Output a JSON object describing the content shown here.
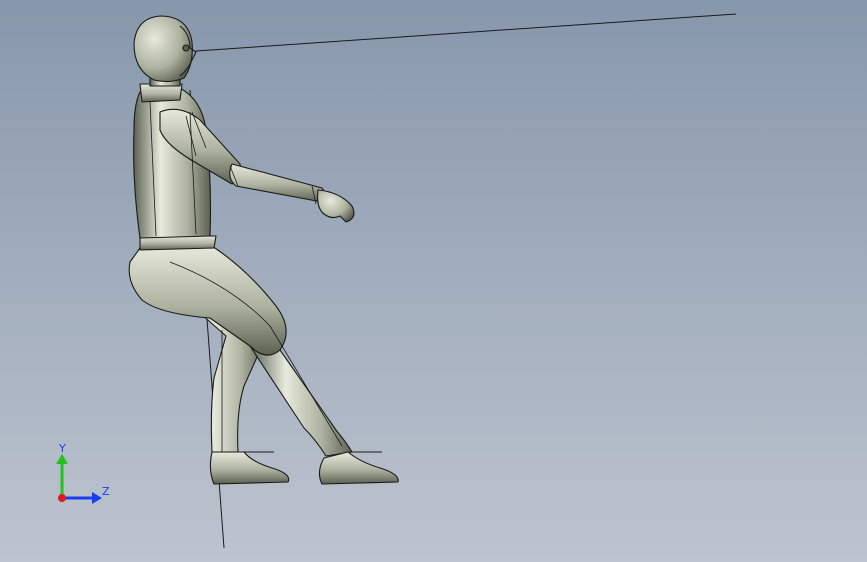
{
  "viewport": {
    "background_top": "#8797ab",
    "background_bottom": "#bdc4cf"
  },
  "model": {
    "body_light": "#e7e9dc",
    "body_mid": "#aeb2a0",
    "body_dark": "#5c6152",
    "edge_color": "#1a1a1a"
  },
  "triad": {
    "y_label": "Y",
    "z_label": "Z",
    "y_color": "#25c21f",
    "z_color": "#1b3df2",
    "x_color": "#e01b1b",
    "label_color": "#1b3df2"
  }
}
